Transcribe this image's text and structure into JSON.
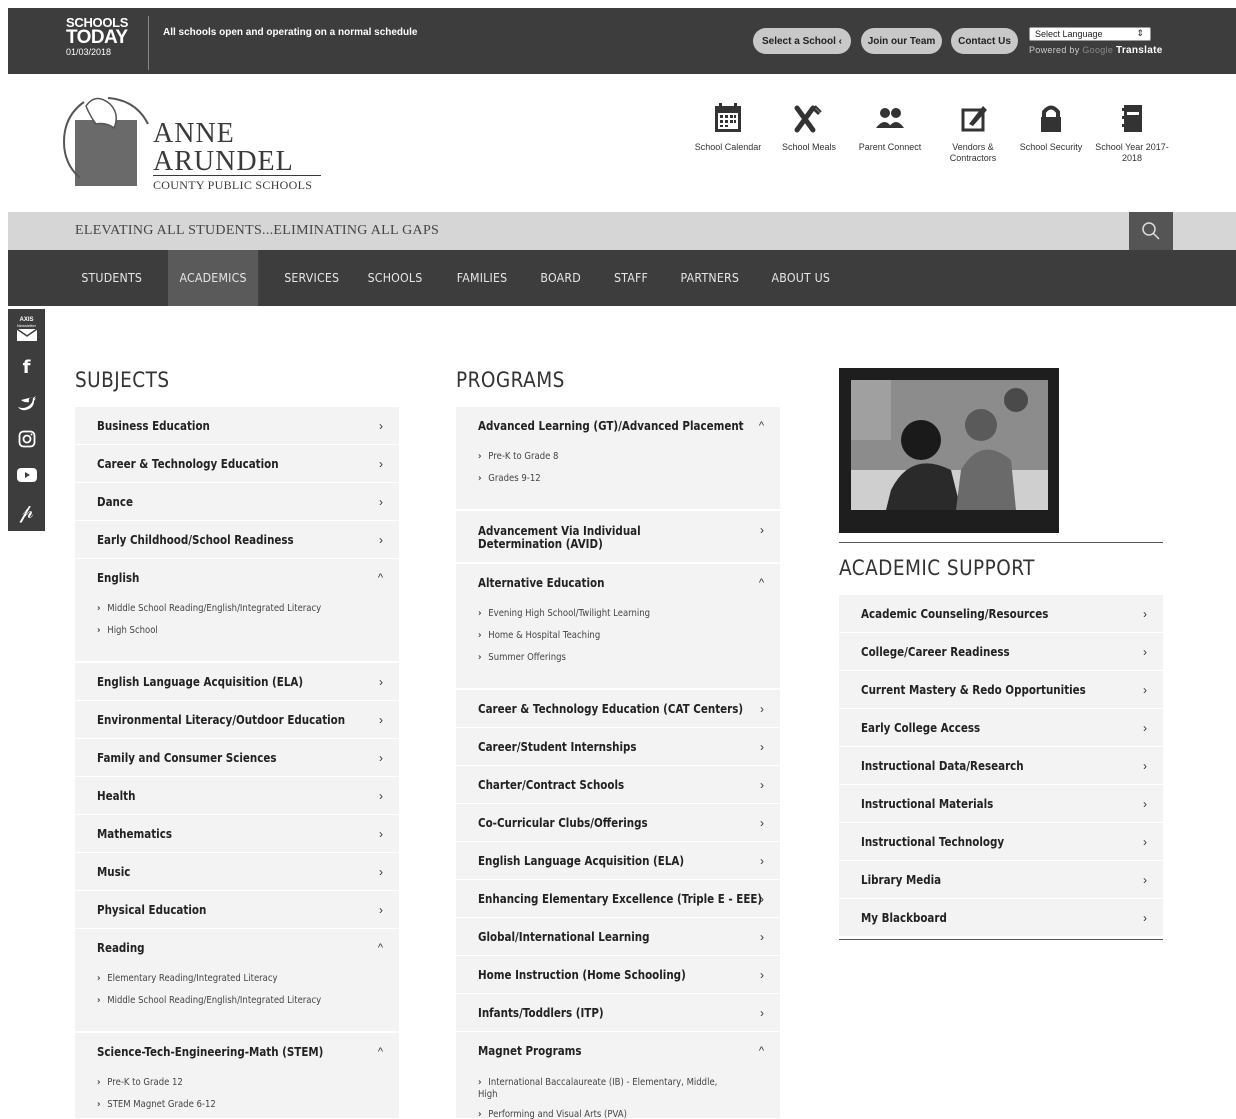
{
  "topbar": {
    "schools_today": {
      "line1": "SCHOOLS",
      "line2": "TODAY",
      "date": "01/03/2018"
    },
    "message": "All schools open and operating on a normal schedule",
    "buttons": {
      "select_school": "Select a School ‹",
      "join_team": "Join our Team",
      "contact": "Contact Us"
    },
    "language": {
      "select_label": "Select Language",
      "powered_by": "Powered by",
      "google": "Google",
      "translate": "Translate"
    }
  },
  "logo": {
    "line1": "ANNE",
    "line2": "ARUNDEL",
    "line3": "COUNTY PUBLIC SCHOOLS"
  },
  "quick_links": [
    {
      "label": "School Calendar",
      "icon": "calendar-icon"
    },
    {
      "label": "School Meals",
      "icon": "utensils-icon"
    },
    {
      "label": "Parent Connect",
      "icon": "people-icon"
    },
    {
      "label": "Vendors & Contractors",
      "icon": "edit-icon"
    },
    {
      "label": "School Security",
      "icon": "lock-icon"
    },
    {
      "label": "School Year 2017-2018",
      "icon": "notebook-icon"
    }
  ],
  "tagline": "ELEVATING ALL STUDENTS...ELIMINATING ALL GAPS",
  "nav": [
    "STUDENTS",
    "ACADEMICS",
    "SERVICES",
    "SCHOOLS",
    "FAMILIES",
    "BOARD",
    "STAFF",
    "PARTNERS",
    "ABOUT US"
  ],
  "social": {
    "axis": "AXIS",
    "newsletter": "Newsletter"
  },
  "subjects": {
    "title": "SUBJECTS",
    "items": [
      "Business Education",
      "Career & Technology Education",
      "Dance",
      "Early Childhood/School Readiness",
      "English",
      "English Language Acquisition (ELA)",
      "Environmental Literacy/Outdoor Education",
      "Family and Consumer Sciences",
      "Health",
      "Mathematics",
      "Music",
      "Physical Education",
      "Reading",
      "Science-Tech-Engineering-Math (STEM)"
    ],
    "english_sub": [
      "Middle School Reading/English/Integrated Literacy",
      "High School"
    ],
    "reading_sub": [
      "Elementary Reading/Integrated Literacy",
      "Middle School Reading/English/Integrated Literacy"
    ],
    "stem_sub": [
      "Pre-K to Grade 12",
      "STEM Magnet Grade 6-12"
    ]
  },
  "programs": {
    "title": "PROGRAMS",
    "items": [
      "Advanced Learning (GT)/Advanced Placement",
      "Advancement Via Individual Determination (AVID)",
      "Alternative Education",
      "Career & Technology Education (CAT Centers)",
      "Career/Student Internships",
      "Charter/Contract Schools",
      "Co-Curricular Clubs/Offerings",
      "English Language Acquisition (ELA)",
      "Enhancing Elementary Excellence (Triple E - EEE)",
      "Global/International Learning",
      "Home Instruction (Home Schooling)",
      "Infants/Toddlers (ITP)",
      "Magnet Programs"
    ],
    "advanced_sub": [
      "Pre-K to Grade 8",
      "Grades 9-12"
    ],
    "alternative_sub": [
      "Evening High School/Twilight Learning",
      "Home & Hospital Teaching",
      "Summer Offerings"
    ],
    "magnet_sub": [
      "International Baccalaureate (IB) - Elementary, Middle, High",
      "Performing and Visual Arts (PVA)"
    ]
  },
  "academic_support": {
    "title": "ACADEMIC SUPPORT",
    "items": [
      "Academic Counseling/Resources",
      "College/Career Readiness",
      "Current Mastery & Redo Opportunities",
      "Early College Access",
      "Instructional Data/Research",
      "Instructional Materials",
      "Instructional Technology",
      "Library Media",
      "My Blackboard"
    ]
  },
  "colors": {
    "topbar": "#3d3d3d",
    "nav": "#3d3d3d",
    "nav_active": "#5a5a5a",
    "tagline_bg": "#d6d6d6",
    "row_bg": "#f3f3f3"
  }
}
